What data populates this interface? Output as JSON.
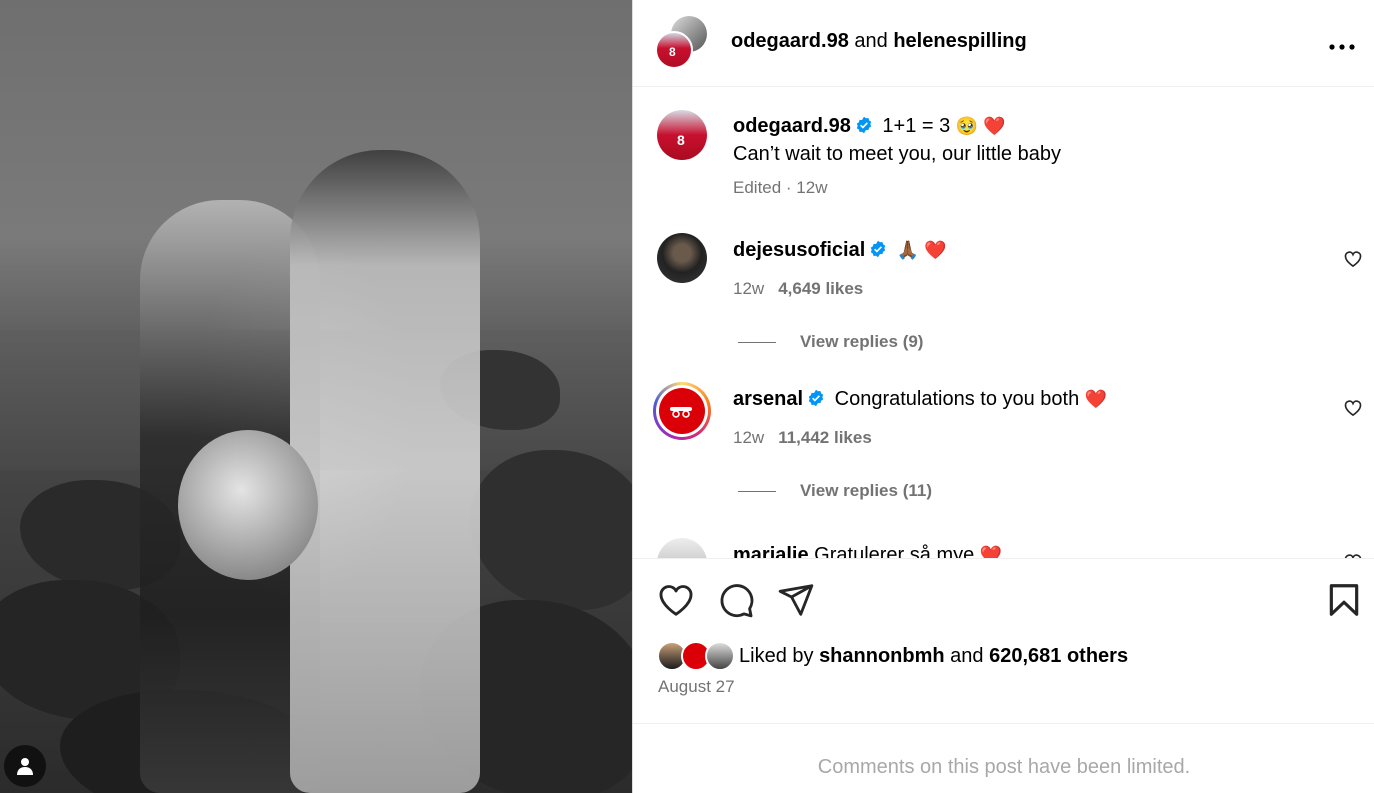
{
  "post": {
    "header": {
      "author": "odegaard.98",
      "joiner": "and",
      "collaborator": "helenespilling"
    },
    "caption": {
      "user": "odegaard.98",
      "line1": "1+1 = 3",
      "line1_emojis": "🥹 ❤️",
      "line2": "Can’t wait to meet you, our little baby",
      "meta": "Edited · 12w"
    },
    "comments": [
      {
        "user": "dejesusoficial",
        "text": "",
        "emojis": "🙏🏾 ❤️",
        "time": "12w",
        "likes": "4,649 likes",
        "replies": "View replies (9)"
      },
      {
        "user": "arsenal",
        "text": "Congratulations to you both",
        "emojis": "❤️",
        "time": "12w",
        "likes": "11,442 likes",
        "replies": "View replies (11)"
      },
      {
        "user": "marialie",
        "text": "Gratulerer så mye",
        "emojis": "❤️"
      }
    ],
    "liked_by": {
      "prefix": "Liked by",
      "user": "shannonbmh",
      "joiner": "and",
      "others": "620,681 others"
    },
    "date": "August 27",
    "limited_notice": "Comments on this post have been limited."
  },
  "colors": {
    "verified": "#0095f6",
    "meta_text": "#737373",
    "limited_text": "#a8a8a8",
    "arsenal_red": "#db0007",
    "heart_emoji": "#e8265e"
  },
  "icons": [
    "more-options-icon",
    "verified-badge-icon",
    "heart-outline-icon",
    "comment-icon",
    "share-icon",
    "bookmark-icon",
    "user-icon"
  ]
}
